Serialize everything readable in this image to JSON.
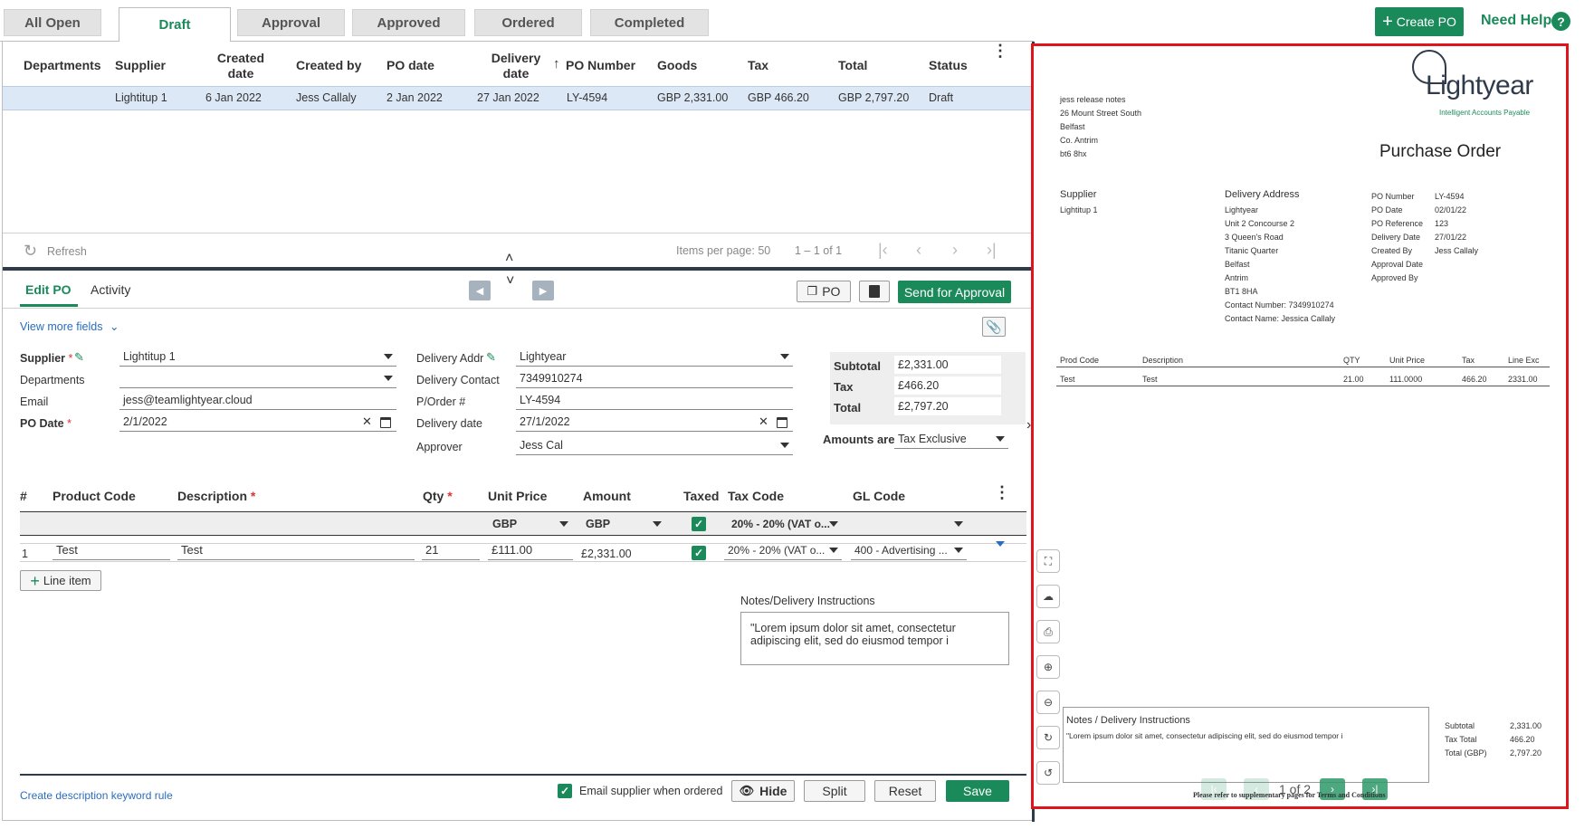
{
  "tabs": [
    {
      "label": "All Open",
      "active": false
    },
    {
      "label": "Draft",
      "active": true
    },
    {
      "label": "Approval",
      "active": false
    },
    {
      "label": "Approved",
      "active": false
    },
    {
      "label": "Ordered",
      "active": false
    },
    {
      "label": "Completed",
      "active": false
    }
  ],
  "header": {
    "create_po": "Create PO",
    "need_help": "Need Help",
    "help_glyph": "?"
  },
  "table": {
    "columns": [
      "Departments",
      "Supplier",
      "Created date",
      "Created by",
      "PO date",
      "Delivery date",
      "PO Number",
      "Goods",
      "Tax",
      "Total",
      "Status"
    ],
    "sort_column": "PO Number",
    "rows": [
      {
        "departments": "",
        "supplier": "Lightitup 1",
        "created_date": "6 Jan 2022",
        "created_by": "Jess Callaly",
        "po_date": "2 Jan 2022",
        "delivery_date": "27 Jan 2022",
        "po_number": "LY-4594",
        "goods": "GBP 2,331.00",
        "tax": "GBP 466.20",
        "total": "GBP 2,797.20",
        "status": "Draft"
      }
    ]
  },
  "pager": {
    "refresh": "Refresh",
    "items_per_page": "Items per page: 50",
    "range": "1 – 1 of 1"
  },
  "edit": {
    "tabs": [
      "Edit PO",
      "Activity"
    ],
    "copy_po": "PO",
    "send_for_approval": "Send for Approval",
    "view_more_fields": "View more fields",
    "labels": {
      "supplier": "Supplier",
      "departments": "Departments",
      "email": "Email",
      "po_date": "PO Date",
      "delivery_addr": "Delivery Addr",
      "delivery_contact": "Delivery Contact",
      "porder": "P/Order #",
      "delivery_date": "Delivery date",
      "approver": "Approver"
    },
    "values": {
      "supplier": "Lightitup 1",
      "departments": "",
      "email": "jess@teamlightyear.cloud",
      "po_date": "2/1/2022",
      "delivery_addr": "Lightyear",
      "delivery_contact": "7349910274",
      "porder": "LY-4594",
      "delivery_date": "27/1/2022",
      "approver": "Jess Cal"
    },
    "totals": {
      "subtotal_label": "Subtotal",
      "subtotal": "£2,331.00",
      "tax_label": "Tax",
      "tax": "£466.20",
      "total_label": "Total",
      "total": "£2,797.20"
    },
    "amounts_are_label": "Amounts are",
    "amounts_are": "Tax Exclusive"
  },
  "lines": {
    "headers": {
      "num": "#",
      "product_code": "Product Code",
      "description": "Description",
      "qty": "Qty",
      "unit_price": "Unit Price",
      "amount": "Amount",
      "taxed": "Taxed",
      "tax_code": "Tax Code",
      "gl_code": "GL Code"
    },
    "defaults": {
      "unit_price_currency": "GBP",
      "amount_currency": "GBP",
      "tax_code": "20% - 20% (VAT o...",
      "gl_code": ""
    },
    "rows": [
      {
        "num": "1",
        "product_code": "Test",
        "description": "Test",
        "qty": "21",
        "unit_price": "£111.00",
        "amount": "£2,331.00",
        "tax_code": "20% - 20% (VAT o...",
        "gl_code": "400 - Advertising ..."
      }
    ],
    "add_line": "Line item"
  },
  "notes": {
    "label": "Notes/Delivery Instructions",
    "text": "\"Lorem ipsum dolor sit amet, consectetur adipiscing elit, sed do eiusmod tempor i"
  },
  "footer": {
    "keyword_rule": "Create description keyword rule",
    "email_supplier": "Email supplier when ordered",
    "hide": "Hide",
    "split": "Split",
    "reset": "Reset",
    "save": "Save"
  },
  "preview": {
    "logo": "Lightyear",
    "logo_tagline": "Intelligent Accounts Payable",
    "from_lines": [
      "jess release notes",
      "26 Mount Street South",
      "Belfast",
      "Co. Antrim",
      "bt6 8hx"
    ],
    "title": "Purchase Order",
    "supplier_label": "Supplier",
    "supplier_value": "Lightitup 1",
    "delivery_label": "Delivery Address",
    "delivery_lines": [
      "Lightyear",
      "Unit 2 Concourse 2",
      "3 Queen's Road",
      "Titanic Quarter",
      "Belfast",
      "Antrim",
      "BT1 8HA",
      "Contact Number: 7349910274",
      "Contact Name: Jessica Callaly"
    ],
    "meta": [
      {
        "k": "PO Number",
        "v": "LY-4594"
      },
      {
        "k": "PO Date",
        "v": "02/01/22"
      },
      {
        "k": "PO Reference",
        "v": "123"
      },
      {
        "k": "Delivery Date",
        "v": "27/01/22"
      },
      {
        "k": "Created By",
        "v": "Jess Callaly"
      },
      {
        "k": "Approval Date",
        "v": ""
      },
      {
        "k": "Approved By",
        "v": ""
      }
    ],
    "line_headers": [
      "Prod Code",
      "Description",
      "QTY",
      "Unit Price",
      "Tax",
      "Line Exc"
    ],
    "line_row": [
      "Test",
      "Test",
      "21.00",
      "111.0000",
      "466.20",
      "2331.00"
    ],
    "notes_label": "Notes / Delivery Instructions",
    "notes_text": "\"Lorem ipsum dolor sit amet, consectetur adipiscing elit, sed do eiusmod tempor i",
    "totals": [
      {
        "k": "Subtotal",
        "v": "2,331.00"
      },
      {
        "k": "Tax Total",
        "v": "466.20"
      },
      {
        "k": "Total (GBP)",
        "v": "2,797.20"
      }
    ],
    "page": "1 of 2",
    "footer_note": "Please refer to supplementary pages for Terms and Conditions"
  },
  "colors": {
    "accent": "#1b8a5a",
    "selected_row": "#dde8f6",
    "preview_border": "#e0151b"
  }
}
